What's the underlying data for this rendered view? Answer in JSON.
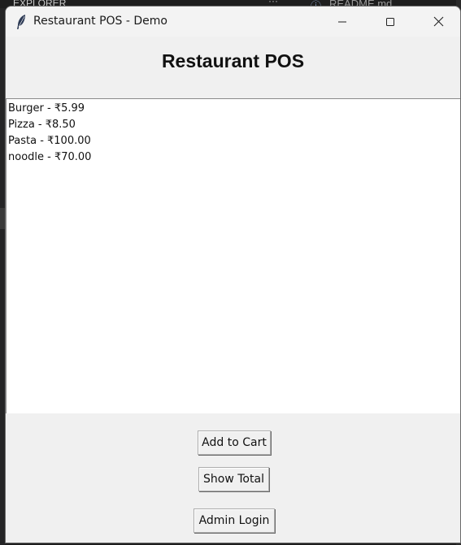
{
  "background": {
    "left_text": "EXPLORER",
    "dots": "···",
    "tab_icon": "ⓘ",
    "tab_label": "README.md"
  },
  "window": {
    "title": "Restaurant POS - Demo",
    "icon": "feather-icon"
  },
  "app": {
    "heading": "Restaurant POS",
    "menu_items": [
      "Burger - ₹5.99",
      "Pizza - ₹8.50",
      "Pasta - ₹100.00",
      "noodle - ₹70.00"
    ],
    "buttons": {
      "add_to_cart": "Add to Cart",
      "show_total": "Show Total",
      "admin_login": "Admin Login"
    }
  }
}
